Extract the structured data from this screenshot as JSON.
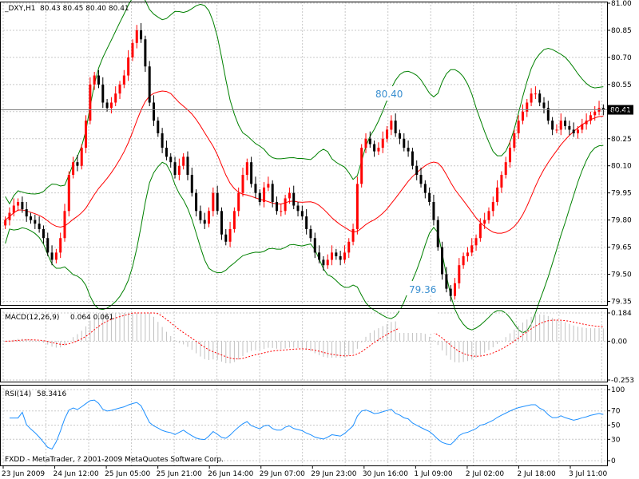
{
  "header": {
    "symbol_label": "_DXY,H1",
    "ohlc": "80.43 80.45 80.40 80.41",
    "macd_label": "MACD(12,26,9)",
    "macd_values": "0.064 0.061",
    "rsi_label": "RSI(14)",
    "rsi_value": "58.3416",
    "copyright": "FXDD - MetaTrader, ? 2001-2009 MetaQuotes Software Corp."
  },
  "annotations": {
    "high_label": "80.40",
    "low_label": "79.36",
    "current_price": "80.41"
  },
  "colors": {
    "bull": "#ff0000",
    "bear": "#000000",
    "sma": "#ff0000",
    "bands": "#008000",
    "macd_hist": "#c0c0c0",
    "macd_signal": "#ff0000",
    "rsi": "#1e90ff",
    "grid": "#c8c8c8",
    "price_line": "#808080",
    "annotation": "#3a8fd0"
  },
  "chart_data": [
    {
      "type": "candlestick",
      "title": "_DXY,H1",
      "x_ticks": [
        "23 Jun 2009",
        "24 Jun 12:00",
        "25 Jun 05:00",
        "25 Jun 21:00",
        "26 Jun 14:00",
        "29 Jun 07:00",
        "29 Jun 23:00",
        "30 Jun 16:00",
        "1 Jul 09:00",
        "2 Jul 02:00",
        "2 Jul 18:00",
        "3 Jul 11:00"
      ],
      "y_ticks": [
        "81.00",
        "80.85",
        "80.70",
        "80.55",
        "80.40",
        "80.25",
        "80.10",
        "79.95",
        "79.80",
        "79.65",
        "79.50",
        "79.35"
      ],
      "ylim": [
        79.33,
        81.0
      ],
      "current_price": 80.41,
      "close_series": [
        79.8,
        79.84,
        79.88,
        79.9,
        79.86,
        79.82,
        79.8,
        79.78,
        79.75,
        79.7,
        79.62,
        79.58,
        79.62,
        79.7,
        79.85,
        80.05,
        80.12,
        80.1,
        80.2,
        80.35,
        80.55,
        80.6,
        80.55,
        80.45,
        80.42,
        80.45,
        80.5,
        80.55,
        80.6,
        80.7,
        80.78,
        80.85,
        80.8,
        80.65,
        80.45,
        80.35,
        80.28,
        80.2,
        80.15,
        80.12,
        80.05,
        80.1,
        80.15,
        80.05,
        79.95,
        79.85,
        79.8,
        79.78,
        79.85,
        79.95,
        79.85,
        79.72,
        79.68,
        79.75,
        79.85,
        79.95,
        80.05,
        80.12,
        80.0,
        79.95,
        79.9,
        79.98,
        80.0,
        79.9,
        79.85,
        79.85,
        79.92,
        79.95,
        79.88,
        79.85,
        79.82,
        79.75,
        79.7,
        79.62,
        79.58,
        79.55,
        79.58,
        79.62,
        79.6,
        79.58,
        79.62,
        79.68,
        79.75,
        80.0,
        80.2,
        80.25,
        80.22,
        80.18,
        80.2,
        80.25,
        80.3,
        80.35,
        80.28,
        80.25,
        80.2,
        80.18,
        80.1,
        80.05,
        80.0,
        79.95,
        79.9,
        79.8,
        79.65,
        79.5,
        79.42,
        79.38,
        79.45,
        79.55,
        79.6,
        79.62,
        79.66,
        79.7,
        79.78,
        79.8,
        79.85,
        79.9,
        79.98,
        80.05,
        80.12,
        80.2,
        80.28,
        80.35,
        80.4,
        80.45,
        80.5,
        80.5,
        80.45,
        80.42,
        80.35,
        80.3,
        80.3,
        80.35,
        80.32,
        80.3,
        80.28,
        80.3,
        80.33,
        80.35,
        80.38,
        80.4,
        80.42,
        80.41
      ],
      "sma_period": 20,
      "bands": {
        "period": 20,
        "deviations": 2
      }
    },
    {
      "type": "histogram",
      "title": "MACD(12,26,9)",
      "y_ticks": [
        "0.184",
        "0.00",
        "-0.253"
      ],
      "ylim": [
        -0.253,
        0.184
      ],
      "main": 0.064,
      "signal": 0.061
    },
    {
      "type": "line",
      "title": "RSI(14)",
      "y_ticks": [
        "100",
        "70",
        "50",
        "30",
        "0"
      ],
      "ylim": [
        0,
        100
      ],
      "last": 58.3416
    }
  ]
}
